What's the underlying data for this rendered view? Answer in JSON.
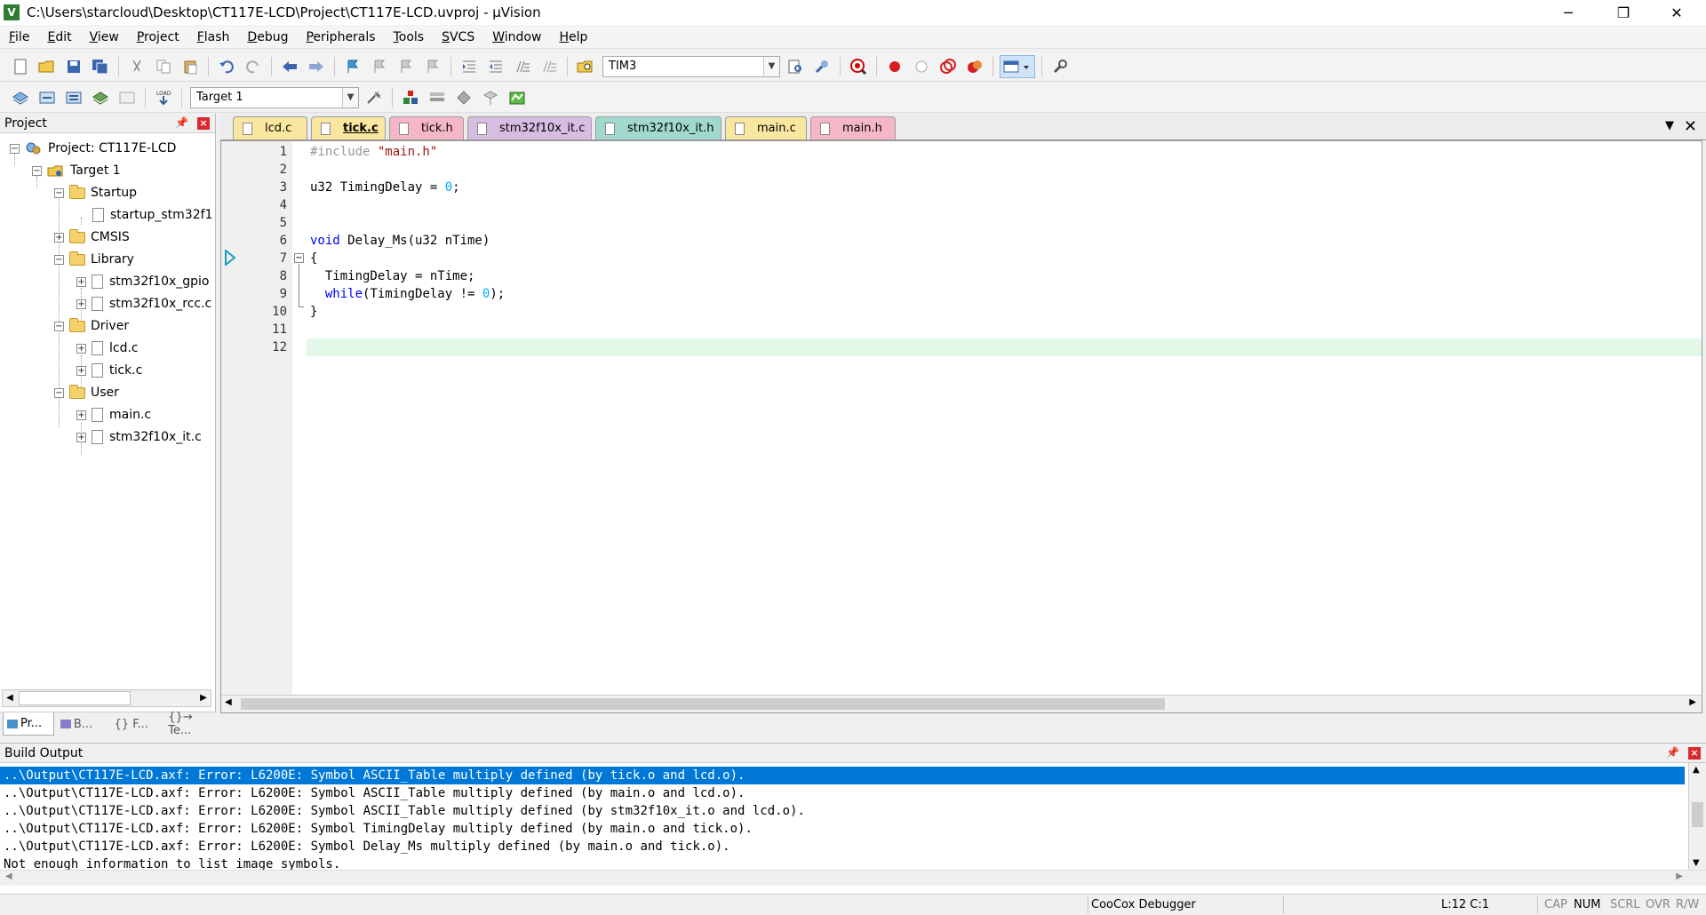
{
  "window": {
    "title": "C:\\Users\\starcloud\\Desktop\\CT117E-LCD\\Project\\CT117E-LCD.uvproj - µVision",
    "app_icon": "V",
    "minimize_glyph": "─",
    "restore_glyph": "❐",
    "close_glyph": "✕"
  },
  "menu": [
    {
      "label": "File",
      "key": "F",
      "rest": "ile"
    },
    {
      "label": "Edit",
      "key": "E",
      "rest": "dit"
    },
    {
      "label": "View",
      "key": "V",
      "rest": "iew"
    },
    {
      "label": "Project",
      "key": "P",
      "rest": "roject"
    },
    {
      "label": "Flash",
      "key": "F",
      "rest": "lash"
    },
    {
      "label": "Debug",
      "key": "D",
      "rest": "ebug"
    },
    {
      "label": "Peripherals",
      "key": "P",
      "rest": "eripherals"
    },
    {
      "label": "Tools",
      "key": "T",
      "rest": "ools"
    },
    {
      "label": "SVCS",
      "key": "S",
      "rest": "VCS"
    },
    {
      "label": "Window",
      "key": "W",
      "rest": "indow"
    },
    {
      "label": "Help",
      "key": "H",
      "rest": "elp"
    }
  ],
  "toolbar": {
    "find_combo_value": "TIM3",
    "target_combo_value": "Target 1"
  },
  "project_panel": {
    "title": "Project",
    "tree": {
      "project": "Project: CT117E-LCD",
      "target": "Target 1",
      "startup": "Startup",
      "startup_file": "startup_stm32f1",
      "cmsis": "CMSIS",
      "library": "Library",
      "lib_gpio": "stm32f10x_gpio",
      "lib_rcc": "stm32f10x_rcc.c",
      "driver": "Driver",
      "drv_lcd": "lcd.c",
      "drv_tick": "tick.c",
      "user": "User",
      "usr_main": "main.c",
      "usr_it": "stm32f10x_it.c"
    },
    "bottom_tabs": [
      "Pr...",
      "B...",
      "{} F...",
      "{}→ Te..."
    ]
  },
  "editor": {
    "tabs": [
      {
        "label": "lcd.c",
        "color": "#f9e79f"
      },
      {
        "label": "tick.c",
        "color": "#f9e79f"
      },
      {
        "label": "tick.h",
        "color": "#f5b7c5"
      },
      {
        "label": "stm32f10x_it.c",
        "color": "#d7bde2"
      },
      {
        "label": "stm32f10x_it.h",
        "color": "#a2d9ce"
      },
      {
        "label": "main.c",
        "color": "#f9e79f"
      },
      {
        "label": "main.h",
        "color": "#f5b7c5"
      }
    ],
    "active_tab": "tick.c",
    "line_numbers": [
      "1",
      "2",
      "3",
      "4",
      "5",
      "6",
      "7",
      "8",
      "9",
      "10",
      "11",
      "12"
    ],
    "code": {
      "l1_pp": "#include ",
      "l1_str": "\"main.h\"",
      "l3_a": "u32 TimingDelay = ",
      "l3_num": "0",
      "l3_b": ";",
      "l6_kw": "void",
      "l6_rest": " Delay_Ms(u32 nTime)",
      "l7": "{",
      "l8": "  TimingDelay = nTime;",
      "l9_kw": "  while",
      "l9_a": "(TimingDelay != ",
      "l9_num": "0",
      "l9_b": ");",
      "l10": "}"
    }
  },
  "build_output": {
    "title": "Build Output",
    "lines": [
      "..\\Output\\CT117E-LCD.axf: Error: L6200E: Symbol ASCII_Table multiply defined (by tick.o and lcd.o).",
      "..\\Output\\CT117E-LCD.axf: Error: L6200E: Symbol ASCII_Table multiply defined (by main.o and lcd.o).",
      "..\\Output\\CT117E-LCD.axf: Error: L6200E: Symbol ASCII_Table multiply defined (by stm32f10x_it.o and lcd.o).",
      "..\\Output\\CT117E-LCD.axf: Error: L6200E: Symbol TimingDelay multiply defined (by main.o and tick.o).",
      "..\\Output\\CT117E-LCD.axf: Error: L6200E: Symbol Delay_Ms multiply defined (by main.o and tick.o).",
      "Not enough information to list image symbols."
    ]
  },
  "statusbar": {
    "debugger": "CooCox Debugger",
    "position": "L:12 C:1",
    "cap": "CAP",
    "num": "NUM",
    "scrl": "SCRL",
    "ovr": "OVR",
    "rw": "R/W"
  }
}
